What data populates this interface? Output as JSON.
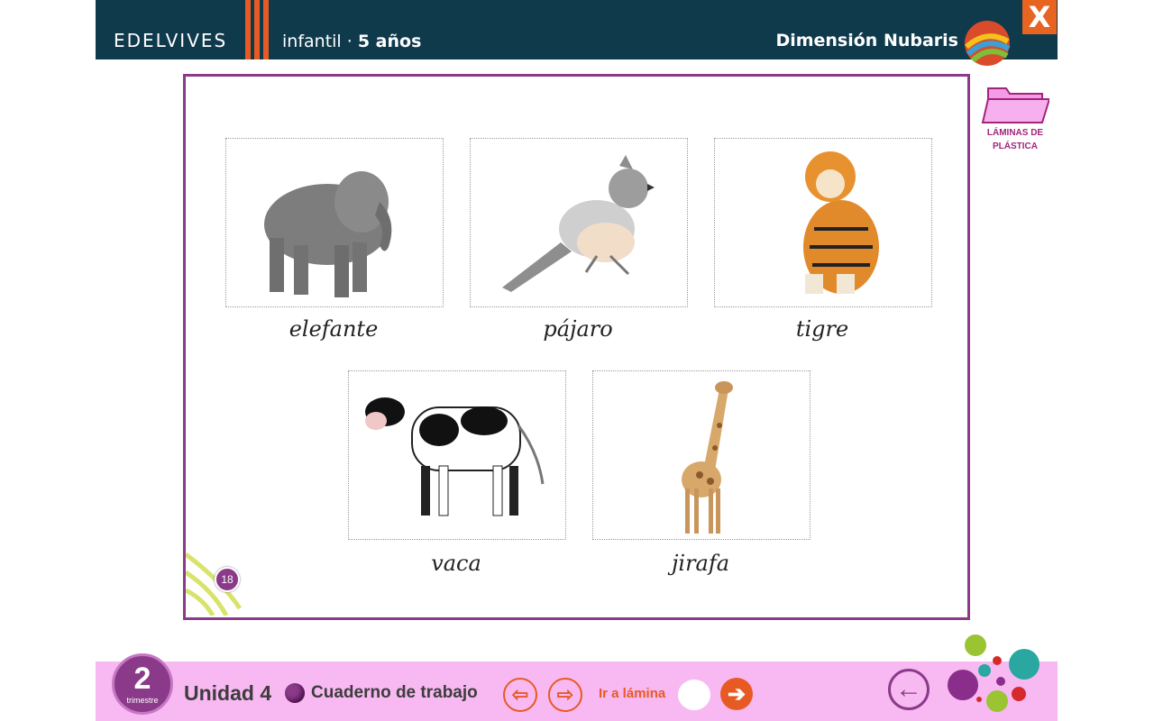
{
  "header": {
    "brand": "EDELVIVES",
    "level_prefix": "infantil · ",
    "level_age": "5 años",
    "series": "Dimensión Nubaris",
    "close_label": "X"
  },
  "sheet": {
    "page_number": "18",
    "cards": [
      {
        "image": "elephant-photo",
        "caption": "elefante"
      },
      {
        "image": "bird-photo",
        "caption": "pájaro"
      },
      {
        "image": "tiger-photo",
        "caption": "tigre"
      },
      {
        "image": "cow-photo",
        "caption": "vaca"
      },
      {
        "image": "giraffe-photo",
        "caption": "jirafa"
      }
    ]
  },
  "folder": {
    "label_line1": "LÁMINAS DE",
    "label_line2": "PLÁSTICA",
    "icon": "folder-icon"
  },
  "footer": {
    "term_number": "2",
    "term_label": "trimestre",
    "unit": "Unidad 4",
    "notebook": "Cuaderno de trabajo",
    "goto_label": "Ir a lámina",
    "goto_value": "",
    "prev_icon": "arrow-left-icon",
    "next_icon": "arrow-right-icon",
    "back_icon": "back-arrow-icon"
  },
  "colors": {
    "header_bg": "#0f3a4c",
    "accent_orange": "#e85a23",
    "purple": "#8b3a8a",
    "footer_bg": "#f8b9f2"
  }
}
